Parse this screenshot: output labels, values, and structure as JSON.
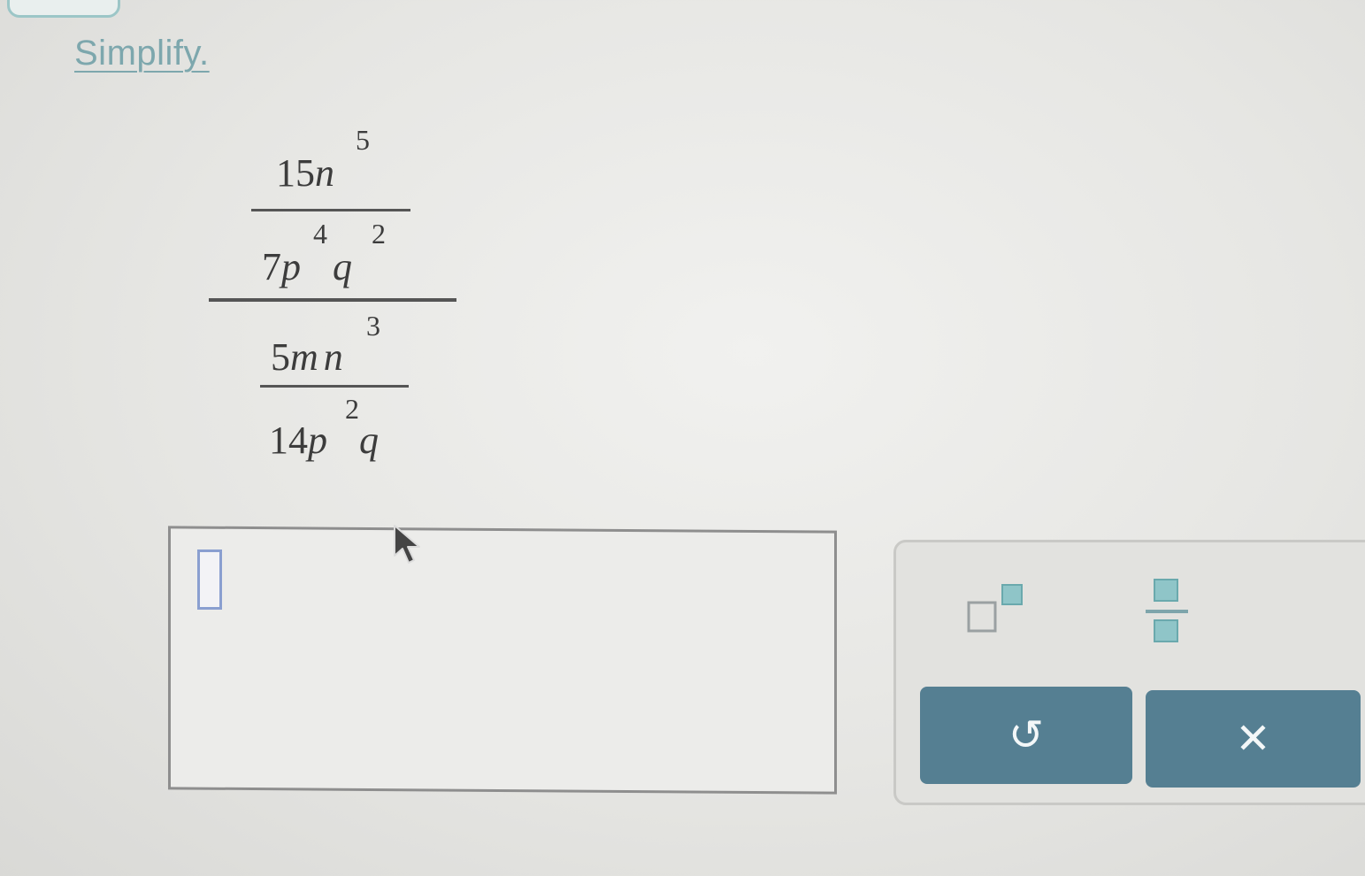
{
  "instruction": "Simplify.",
  "expression": {
    "outer_numerator": {
      "numerator": {
        "coef": "15",
        "var": "n",
        "exp": "5"
      },
      "denominator": {
        "coef": "7",
        "var1": "p",
        "exp1": "4",
        "var2": "q",
        "exp2": "2"
      }
    },
    "outer_denominator": {
      "numerator": {
        "coef": "5",
        "var1": "m",
        "var2": "n",
        "exp2": "3"
      },
      "denominator": {
        "coef": "14",
        "var1": "p",
        "exp1": "2",
        "var2": "q"
      }
    }
  },
  "toolbar": {
    "tools": [
      {
        "icon": "superscript-icon"
      },
      {
        "icon": "fraction-icon"
      }
    ],
    "undo_glyph": "↺",
    "clear_glyph": "✕"
  },
  "colors": {
    "accent": "#7da7ad",
    "button": "#557f92",
    "icon_fill": "#8fc5c8"
  }
}
